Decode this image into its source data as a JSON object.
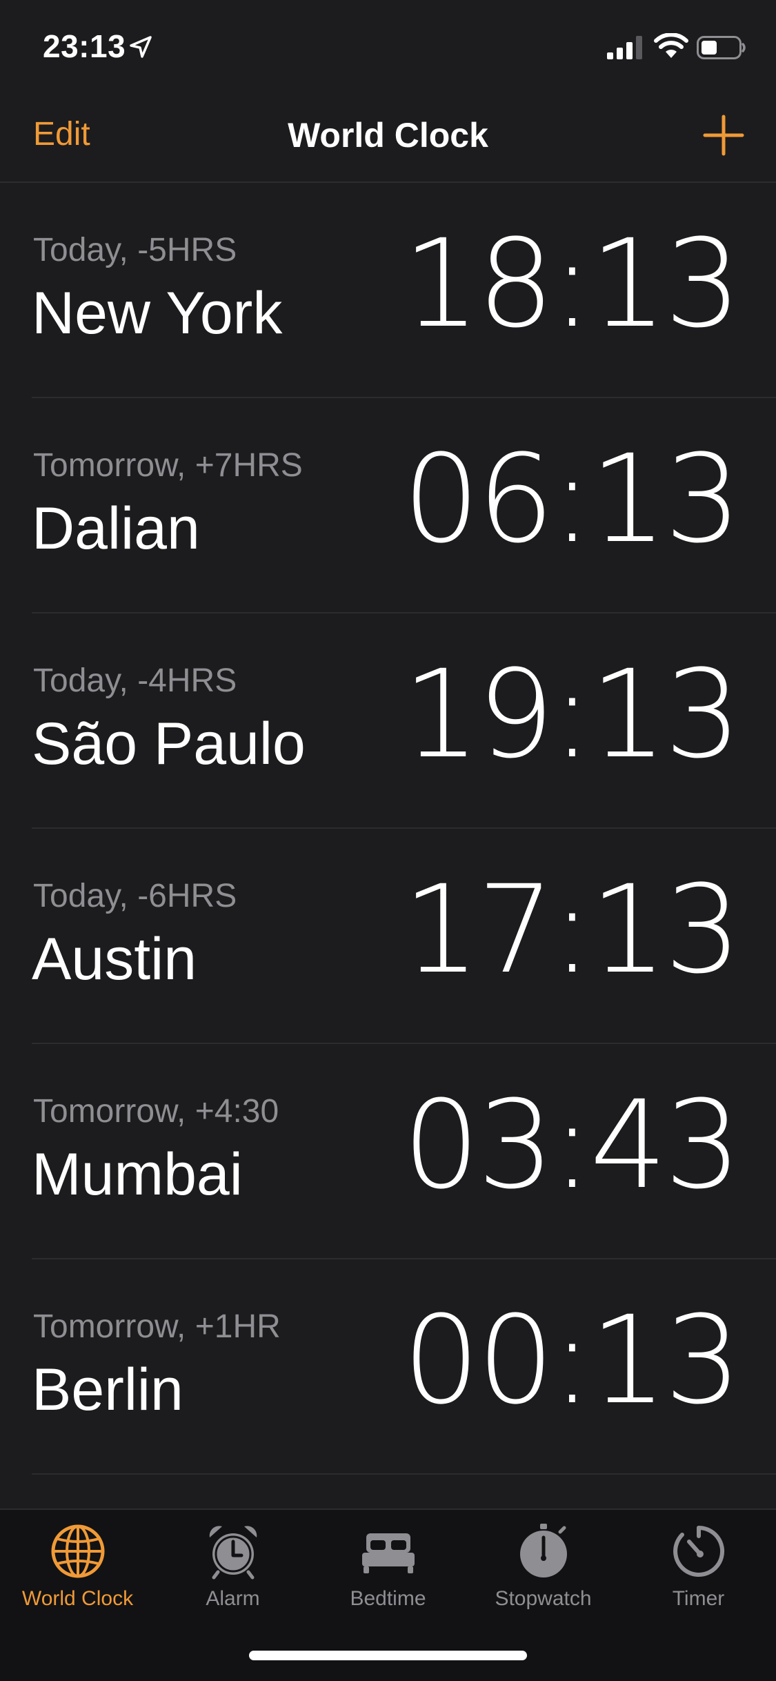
{
  "status_bar": {
    "time": "23:13"
  },
  "nav": {
    "edit_label": "Edit",
    "title": "World Clock"
  },
  "clocks": [
    {
      "offset": "Today, -5HRS",
      "city": "New York",
      "time": "18:13"
    },
    {
      "offset": "Tomorrow, +7HRS",
      "city": "Dalian",
      "time": "06:13"
    },
    {
      "offset": "Today, -4HRS",
      "city": "São Paulo",
      "time": "19:13"
    },
    {
      "offset": "Today, -6HRS",
      "city": "Austin",
      "time": "17:13"
    },
    {
      "offset": "Tomorrow, +4:30",
      "city": "Mumbai",
      "time": "03:43"
    },
    {
      "offset": "Tomorrow, +1HR",
      "city": "Berlin",
      "time": "00:13"
    }
  ],
  "tabs": [
    {
      "label": "World Clock",
      "icon": "globe-icon",
      "active": true
    },
    {
      "label": "Alarm",
      "icon": "alarm-clock-icon",
      "active": false
    },
    {
      "label": "Bedtime",
      "icon": "bed-icon",
      "active": false
    },
    {
      "label": "Stopwatch",
      "icon": "stopwatch-icon",
      "active": false
    },
    {
      "label": "Timer",
      "icon": "timer-icon",
      "active": false
    }
  ],
  "colors": {
    "accent": "#f09a37",
    "background": "#1c1c1e",
    "secondary_text": "#8e8e93",
    "separator": "#2c2c2e"
  }
}
